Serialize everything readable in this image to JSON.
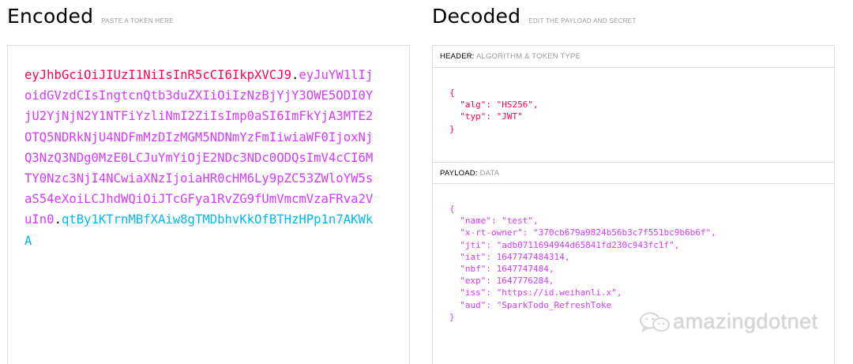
{
  "encoded": {
    "title": "Encoded",
    "subtitle": "PASTE A TOKEN HERE",
    "token": {
      "header": "eyJhbGciOiJIUzI1NiIsInR5cCI6IkpXVCJ9",
      "dot1": ".",
      "payload": "eyJuYW1lIjoidGVzdCIsIngtcnQtb3duZXIiOiIzNzBjYjY3OWE5ODI0YjU2YjNjN2Y1NTFiYzliNmI2ZiIsImp0aSI6ImFkYjA3MTE2OTQ5NDRkNjU4NDFmMzDIzMGM5NDNmYzFmIiwiaWF0IjoxNjQ3NzQ3NDg0MzE0LCJuYmYiOjE2NDc3NDc0ODQsImV4cCI6MTY0Nzc3NjI4NCwiaXNzIjoiaHR0cHM6Ly9pZC53ZWloYW5saS54eXoiLCJhdWQiOiJTcGFya1RvZG9fUmVmcmVzaFRva2VuIn0",
      "dot2": ".",
      "signature": "qtBy1KTrnMBfXAiw8gTMDbhvKkOfBTHzHPp1n7AKWkA"
    }
  },
  "decoded": {
    "title": "Decoded",
    "subtitle": "EDIT THE PAYLOAD AND SECRET",
    "header_section": {
      "label": "HEADER:",
      "sublabel": "ALGORITHM & TOKEN TYPE",
      "code": "{\n  \"alg\": \"HS256\",\n  \"typ\": \"JWT\"\n}"
    },
    "payload_section": {
      "label": "PAYLOAD:",
      "sublabel": "DATA",
      "code": "{\n  \"name\": \"test\",\n  \"x-rt-owner\": \"370cb679a9824b56b3c7f551bc9b6b6f\",\n  \"jti\": \"adb0711694944d65841fd230c943fc1f\",\n  \"iat\": 1647747484314,\n  \"nbf\": 1647747484,\n  \"exp\": 1647776284,\n  \"iss\": \"https://id.weihanli.x\",\n  \"aud\": \"SparkTodo_RefreshToke\n}"
    }
  },
  "watermark": {
    "text": "amazingdotnet",
    "icon": "wechat-icon"
  },
  "colors": {
    "header": "#fb015b",
    "payload": "#d63aff",
    "signature": "#00b9f1"
  }
}
